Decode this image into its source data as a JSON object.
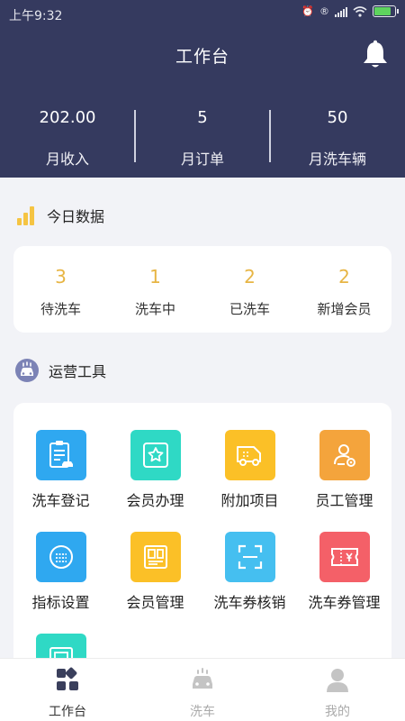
{
  "status_bar": {
    "time": "上午9:32",
    "battery_fraction": 0.85
  },
  "header": {
    "title": "工作台"
  },
  "stats": [
    {
      "value": "202.00",
      "label": "月收入"
    },
    {
      "value": "5",
      "label": "月订单"
    },
    {
      "value": "50",
      "label": "月洗车辆"
    }
  ],
  "today": {
    "title": "今日数据",
    "items": [
      {
        "value": "3",
        "label": "待洗车"
      },
      {
        "value": "1",
        "label": "洗车中"
      },
      {
        "value": "2",
        "label": "已洗车"
      },
      {
        "value": "2",
        "label": "新增会员"
      }
    ]
  },
  "tools": {
    "title": "运营工具",
    "items": [
      {
        "label": "洗车登记",
        "icon": "clipboard-car-icon",
        "color": "#2fa8f0"
      },
      {
        "label": "会员办理",
        "icon": "member-card-icon",
        "color": "#2fd9c5"
      },
      {
        "label": "附加项目",
        "icon": "van-icon",
        "color": "#fbc027"
      },
      {
        "label": "员工管理",
        "icon": "staff-icon",
        "color": "#f4a43c"
      },
      {
        "label": "指标设置",
        "icon": "indicator-icon",
        "color": "#2fa8f0"
      },
      {
        "label": "会员管理",
        "icon": "member-manage-icon",
        "color": "#fbc027"
      },
      {
        "label": "洗车券核销",
        "icon": "scan-icon",
        "color": "#45bff0"
      },
      {
        "label": "洗车券管理",
        "icon": "coupon-icon",
        "color": "#f46068"
      },
      {
        "label": "",
        "icon": "more-tool-icon",
        "color": "#2fd9c5"
      }
    ]
  },
  "tabbar": [
    {
      "label": "工作台",
      "icon": "dashboard-icon",
      "active": true
    },
    {
      "label": "洗车",
      "icon": "car-wash-icon",
      "active": false
    },
    {
      "label": "我的",
      "icon": "profile-icon",
      "active": false
    }
  ]
}
